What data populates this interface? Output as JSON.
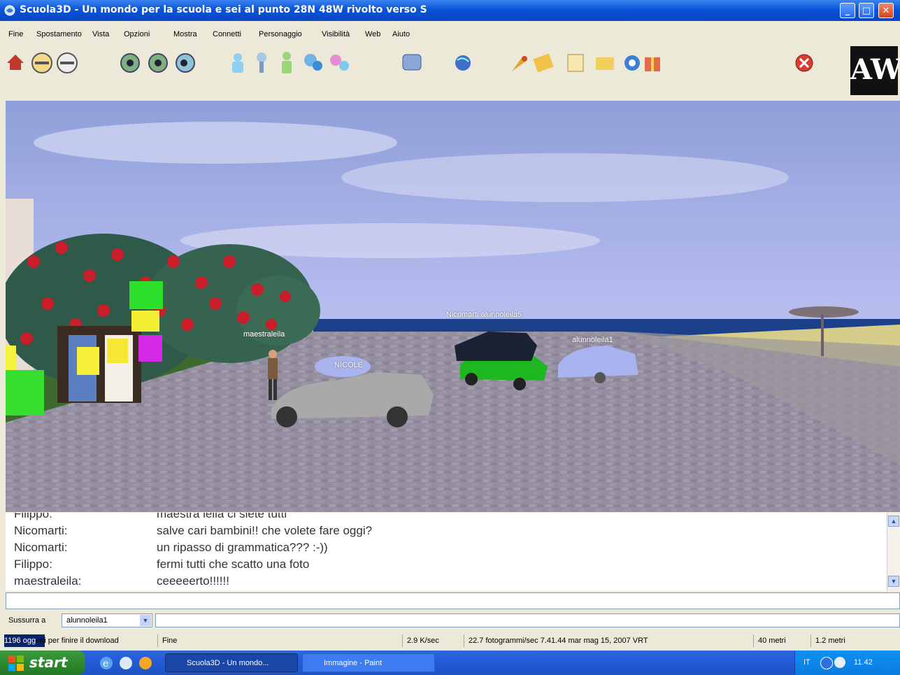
{
  "window": {
    "title": "Scuola3D - Un mondo per la scuola e sei al punto 28N 48W rivolto verso S",
    "min": "_",
    "max": "□",
    "close": "✕"
  },
  "menu": [
    "Fine",
    "Spostamento",
    "Vista",
    "Opzioni",
    "Mostra",
    "Connetti",
    "Personaggio",
    "Visibilità",
    "Web",
    "Aiuto"
  ],
  "logo": "AW",
  "scene": {
    "tags": {
      "maestraleila": "maestraleila",
      "nicomarti_group": "Nicomarti alunnoleila5",
      "nicole": "NICOLE",
      "alunnoleila1": "alunnoleila1"
    }
  },
  "chat": {
    "cut_top": {
      "who": "Filippo:",
      "msg": "maestra leila ci siete tutti"
    },
    "lines": [
      {
        "who": "Nicomarti:",
        "msg": "salve cari bambini!! che volete fare oggi?"
      },
      {
        "who": "Nicomarti:",
        "msg": "un ripasso di grammatica??? :-))"
      },
      {
        "who": "Filippo:",
        "msg": "fermi tutti che scatto una foto"
      },
      {
        "who": "maestraleila:",
        "msg": "ceeeeerto!!!!!!"
      }
    ]
  },
  "whisper": {
    "label": "Sussurra a",
    "selected": "alunnoleila1"
  },
  "status": {
    "download_hi": "1196 ogg",
    "download_rest": "etti per finire il download",
    "state": "Fine",
    "rate": "2.9 K/sec",
    "fps_time": "22.7 fotogrammi/sec 7.41.44 mar mag 15, 2007 VRT",
    "visibility": "40 metri",
    "height": "1.2 metri"
  },
  "taskbar": {
    "start": "start",
    "items": [
      "Scuola3D - Un mondo...",
      "Immagine - Paint"
    ],
    "lang": "IT",
    "clock": "11.42"
  },
  "colors": {
    "titlebar": "#0a53d8",
    "sky": "#a9b3e0",
    "sea": "#1c3f8a",
    "paving": "#8f8a99"
  }
}
